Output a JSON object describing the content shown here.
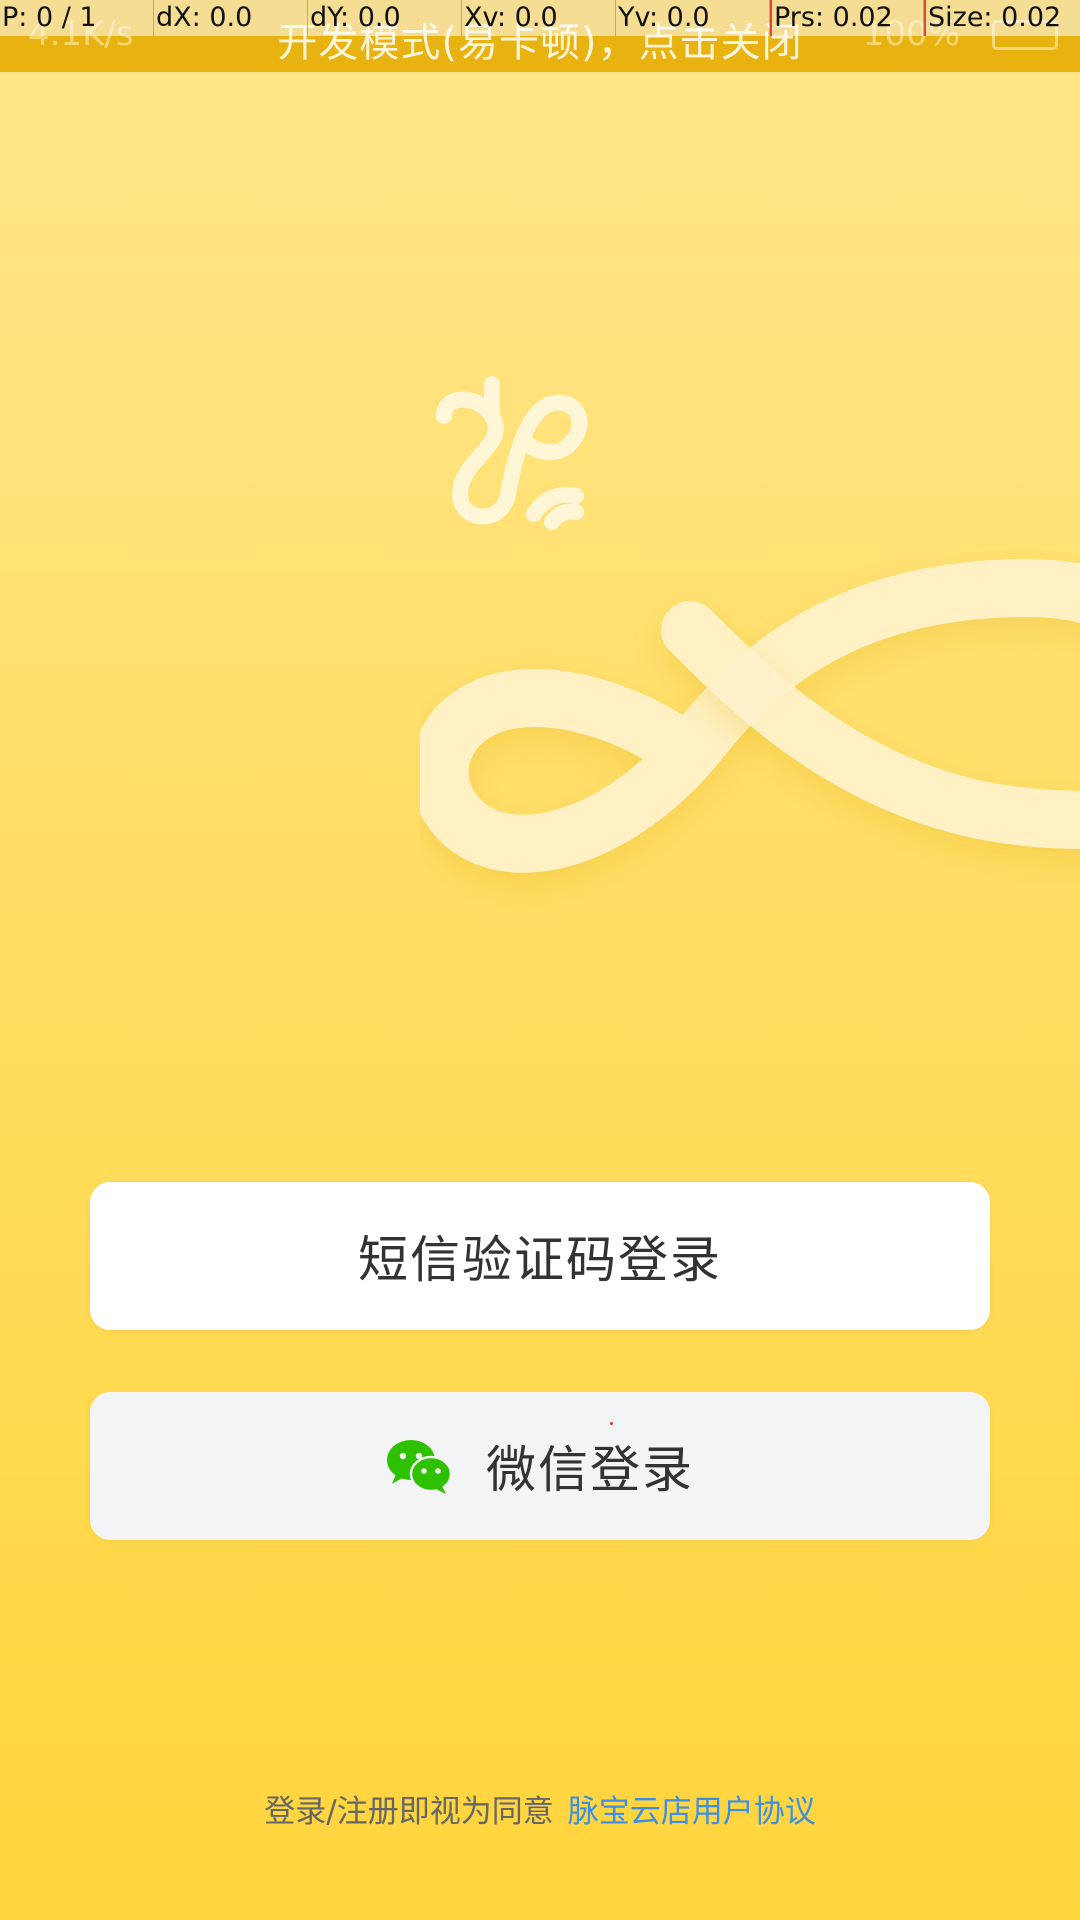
{
  "debug_overlay": {
    "pointer": "P: 0 / 1",
    "dx": "dX: 0.0",
    "dy": "dY: 0.0",
    "xv": "Xv: 0.0",
    "yv": "Yv: 0.0",
    "prs": "Prs: 0.02",
    "size": "Size: 0.02"
  },
  "status_bar": {
    "network_speed": "4.1K/s",
    "battery": "100%",
    "dev_mode_banner": "开发模式(易卡顿)，点击关闭",
    "background_color": "#E8B311"
  },
  "logo": {
    "icon": "app-logo-icon"
  },
  "login": {
    "sms_button_label": "短信验证码登录",
    "wechat_button_label": "微信登录",
    "wechat_icon": "wechat-icon",
    "wechat_color": "#2DC100"
  },
  "agreement": {
    "prefix": "登录/注册即视为同意",
    "link_text": "脉宝云店用户协议",
    "link_color": "#3D8FE3"
  },
  "theme": {
    "background_top": "#FFE68A",
    "background_bottom": "#FFD53C"
  }
}
